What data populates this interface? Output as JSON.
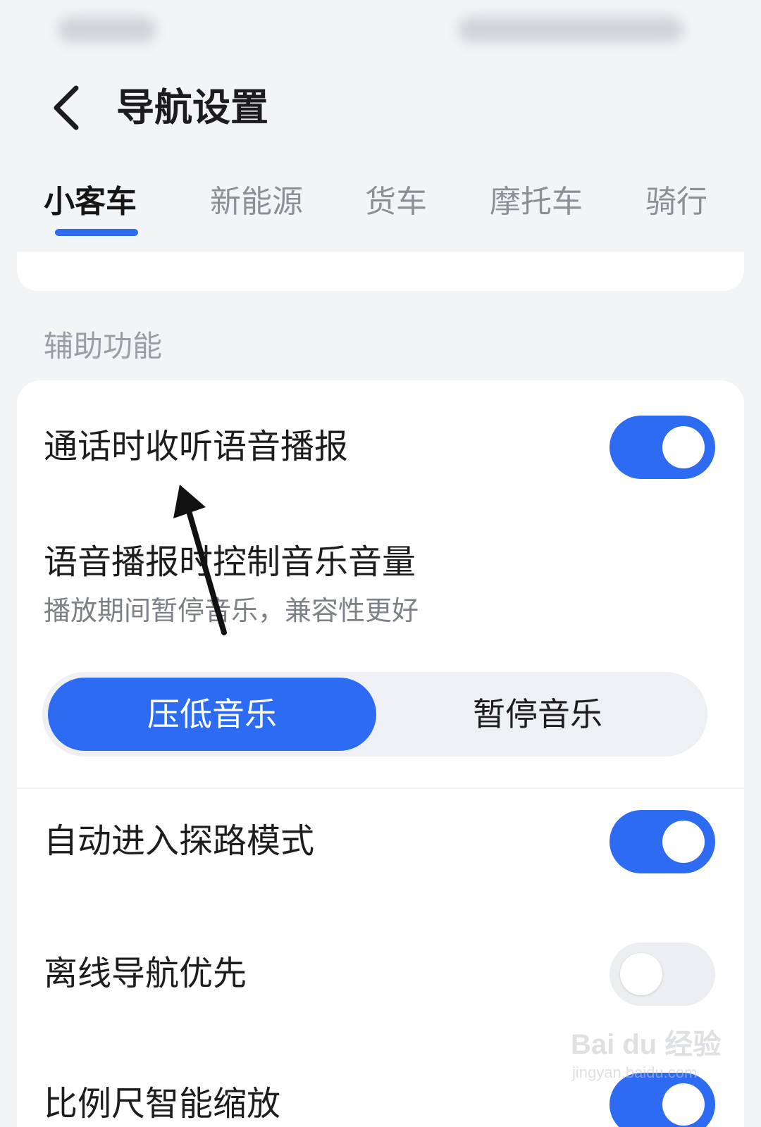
{
  "header": {
    "title": "导航设置"
  },
  "tabs": [
    {
      "label": "小客车",
      "active": true
    },
    {
      "label": "新能源",
      "active": false
    },
    {
      "label": "货车",
      "active": false
    },
    {
      "label": "摩托车",
      "active": false
    },
    {
      "label": "骑行",
      "active": false
    }
  ],
  "section": {
    "title": "辅助功能"
  },
  "settings": {
    "call_broadcast": {
      "label": "通话时收听语音播报",
      "enabled": true
    },
    "music_volume": {
      "label": "语音播报时控制音乐音量",
      "subtitle": "播放期间暂停音乐，兼容性更好",
      "options": [
        "压低音乐",
        "暂停音乐"
      ],
      "selected": "压低音乐"
    },
    "explore_mode": {
      "label": "自动进入探路模式",
      "enabled": true
    },
    "offline_first": {
      "label": "离线导航优先",
      "enabled": false
    },
    "smart_zoom": {
      "label": "比例尺智能缩放",
      "enabled": true
    }
  },
  "watermark": {
    "brand": "Bai du 经验",
    "url": "jingyan.baidu.com"
  },
  "colors": {
    "accent": "#2d6cf2",
    "background": "#f3f4f6",
    "card": "#ffffff"
  },
  "icons": [
    "back-chevron-icon"
  ]
}
